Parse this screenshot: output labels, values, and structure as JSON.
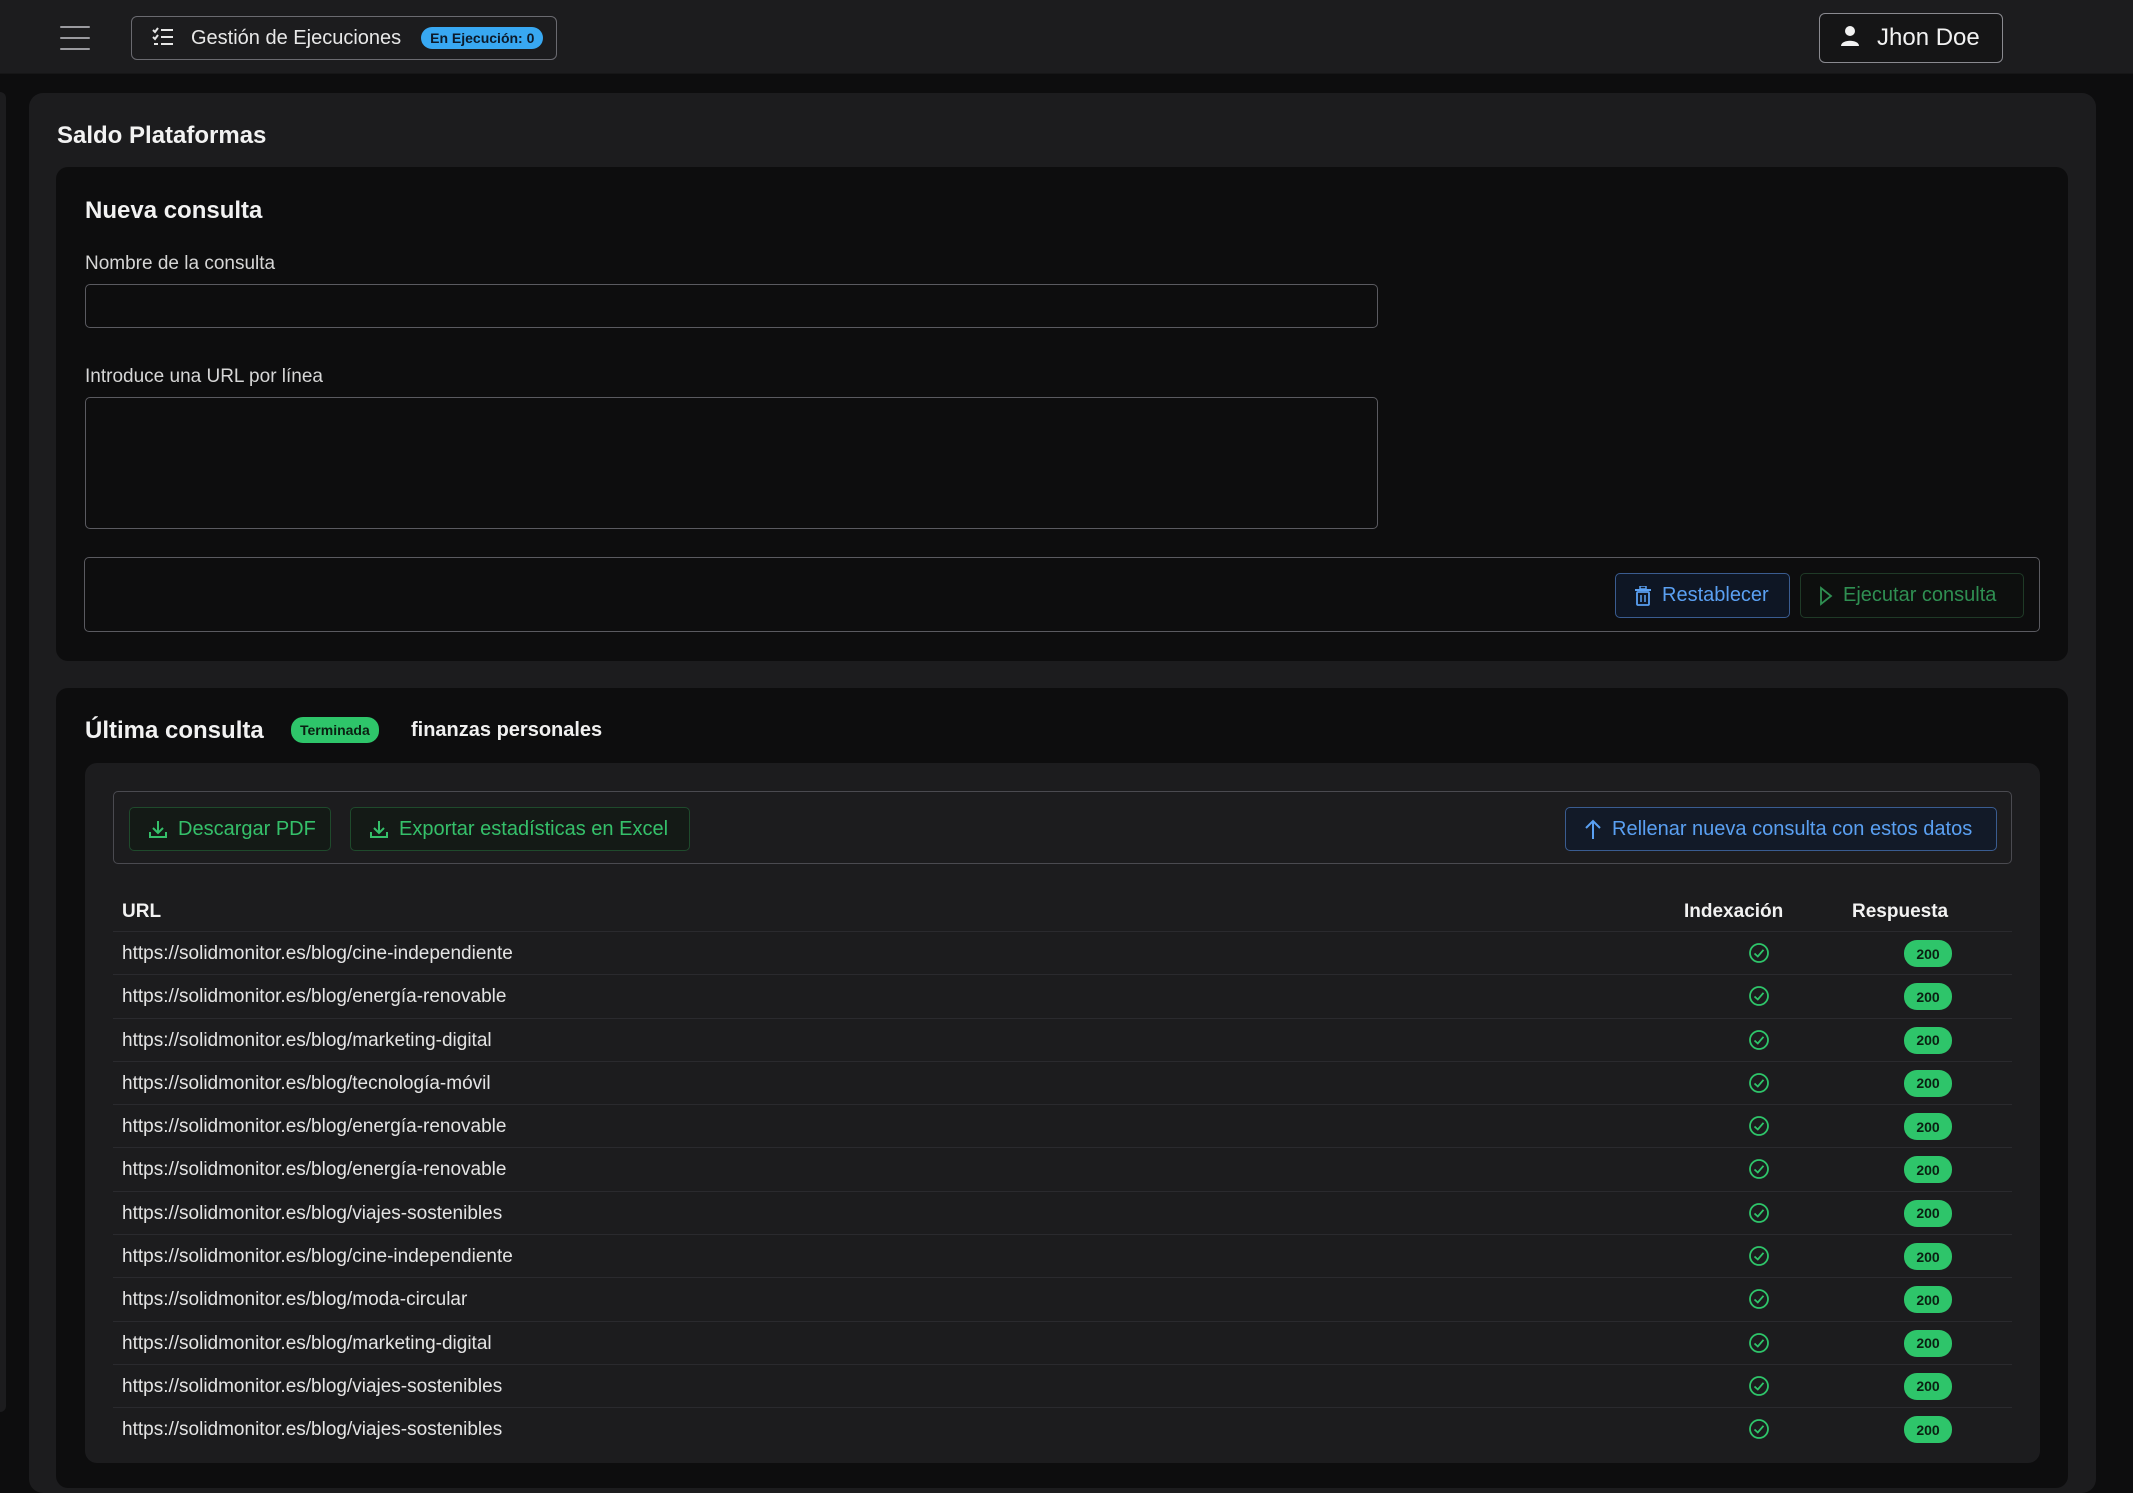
{
  "topbar": {
    "menu_icon": "hamburger-menu-icon",
    "executions_label": "Gestión de Ejecuciones",
    "executions_badge": "En Ejecución: 0",
    "user_name": "Jhon Doe"
  },
  "page": {
    "title": "Saldo Plataformas"
  },
  "new_query": {
    "title": "Nueva consulta",
    "name_label": "Nombre de la consulta",
    "name_value": "",
    "urls_label": "Introduce una URL por línea",
    "urls_value": "",
    "reset_label": "Restablecer",
    "execute_label": "Ejecutar consulta"
  },
  "last_query": {
    "title": "Última consulta",
    "status_badge": "Terminada",
    "name": "finanzas personales",
    "download_pdf_label": "Descargar PDF",
    "export_excel_label": "Exportar estadísticas en Excel",
    "fill_new_label": "Rellenar nueva consulta con estos datos",
    "columns": {
      "url": "URL",
      "indexation": "Indexación",
      "response": "Respuesta"
    },
    "rows": [
      {
        "url": "https://solidmonitor.es/blog/cine-independiente",
        "indexed": true,
        "response": "200"
      },
      {
        "url": "https://solidmonitor.es/blog/energía-renovable",
        "indexed": true,
        "response": "200"
      },
      {
        "url": "https://solidmonitor.es/blog/marketing-digital",
        "indexed": true,
        "response": "200"
      },
      {
        "url": "https://solidmonitor.es/blog/tecnología-móvil",
        "indexed": true,
        "response": "200"
      },
      {
        "url": "https://solidmonitor.es/blog/energía-renovable",
        "indexed": true,
        "response": "200"
      },
      {
        "url": "https://solidmonitor.es/blog/energía-renovable",
        "indexed": true,
        "response": "200"
      },
      {
        "url": "https://solidmonitor.es/blog/viajes-sostenibles",
        "indexed": true,
        "response": "200"
      },
      {
        "url": "https://solidmonitor.es/blog/cine-independiente",
        "indexed": true,
        "response": "200"
      },
      {
        "url": "https://solidmonitor.es/blog/moda-circular",
        "indexed": true,
        "response": "200"
      },
      {
        "url": "https://solidmonitor.es/blog/marketing-digital",
        "indexed": true,
        "response": "200"
      },
      {
        "url": "https://solidmonitor.es/blog/viajes-sostenibles",
        "indexed": true,
        "response": "200"
      },
      {
        "url": "https://solidmonitor.es/blog/viajes-sostenibles",
        "indexed": true,
        "response": "200"
      }
    ]
  },
  "colors": {
    "accent_green": "#2ec56a",
    "accent_blue": "#38a8f2",
    "background": "#0d0d0e",
    "surface": "#1c1c1e"
  }
}
